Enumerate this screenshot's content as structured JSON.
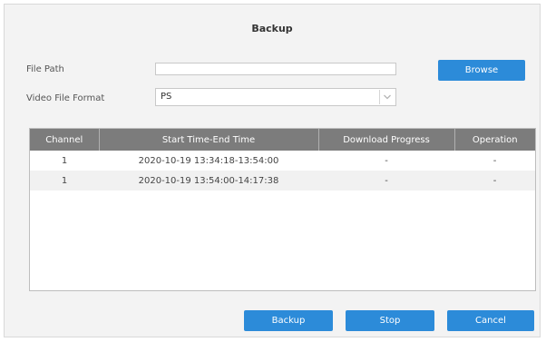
{
  "dialog": {
    "title": "Backup"
  },
  "form": {
    "file_path_label": "File Path",
    "file_path_value": "",
    "browse_label": "Browse",
    "video_format_label": "Video File Format",
    "video_format_value": "PS"
  },
  "table": {
    "headers": [
      "Channel",
      "Start Time-End Time",
      "Download Progress",
      "Operation"
    ],
    "rows": [
      [
        "1",
        "2020-10-19 13:34:18-13:54:00",
        "-",
        "-"
      ],
      [
        "1",
        "2020-10-19 13:54:00-14:17:38",
        "-",
        "-"
      ]
    ]
  },
  "footer": {
    "backup_label": "Backup",
    "stop_label": "Stop",
    "cancel_label": "Cancel"
  },
  "icons": {
    "select_arrow": "chevron-down-icon"
  },
  "colors": {
    "accent": "#2c8bd9",
    "table_header": "#7c7c7c"
  }
}
